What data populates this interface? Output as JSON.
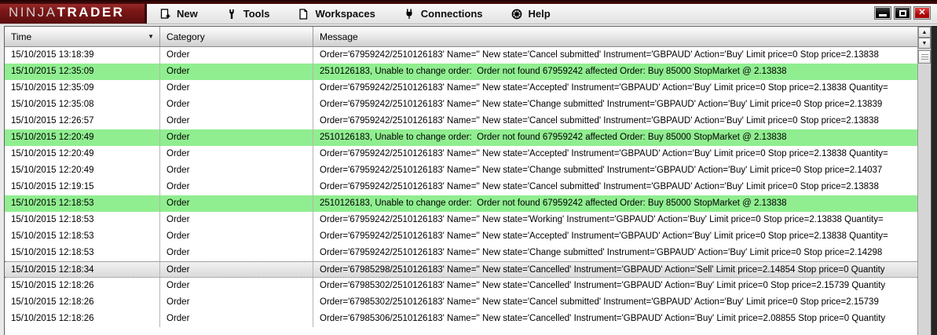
{
  "window": {
    "logo": {
      "brand_light": "NINJA",
      "brand_bold": "TRADER"
    },
    "menu": [
      {
        "label": "New",
        "icon": "new-document-icon"
      },
      {
        "label": "Tools",
        "icon": "wrench-icon"
      },
      {
        "label": "Workspaces",
        "icon": "workspace-document-icon"
      },
      {
        "label": "Connections",
        "icon": "plug-icon"
      },
      {
        "label": "Help",
        "icon": "globe-icon"
      }
    ],
    "controls": [
      {
        "name": "minimize",
        "icon": "minimize-icon"
      },
      {
        "name": "maximize",
        "icon": "maximize-icon"
      },
      {
        "name": "close",
        "icon": "close-icon"
      }
    ]
  },
  "glyphs": {
    "sort_dropdown": "▼",
    "scroll_up": "▲",
    "scroll_down": "▼",
    "close": "✕"
  },
  "colors": {
    "brand_red": "#7c1717",
    "highlight_green": "#90EE90",
    "selected_gray": "#e2e2e2",
    "close_red": "#c41212"
  },
  "table": {
    "columns": [
      "Time",
      "Category",
      "Message"
    ],
    "rows": [
      {
        "time": "15/10/2015 13:18:39",
        "category": "Order",
        "state": "normal",
        "message": "Order='67959242/2510126183' Name='' New state='Cancel submitted' Instrument='GBPAUD' Action='Buy' Limit price=0 Stop price=2.13838"
      },
      {
        "time": "15/10/2015 12:35:09",
        "category": "Order",
        "state": "highlight",
        "message": "2510126183, Unable to change order:  Order not found 67959242 affected Order: Buy 85000 StopMarket @ 2.13838"
      },
      {
        "time": "15/10/2015 12:35:09",
        "category": "Order",
        "state": "normal",
        "message": "Order='67959242/2510126183' Name='' New state='Accepted' Instrument='GBPAUD' Action='Buy' Limit price=0 Stop price=2.13838 Quantity="
      },
      {
        "time": "15/10/2015 12:35:08",
        "category": "Order",
        "state": "normal",
        "message": "Order='67959242/2510126183' Name='' New state='Change submitted' Instrument='GBPAUD' Action='Buy' Limit price=0 Stop price=2.13839"
      },
      {
        "time": "15/10/2015 12:26:57",
        "category": "Order",
        "state": "normal",
        "message": "Order='67959242/2510126183' Name='' New state='Cancel submitted' Instrument='GBPAUD' Action='Buy' Limit price=0 Stop price=2.13838"
      },
      {
        "time": "15/10/2015 12:20:49",
        "category": "Order",
        "state": "highlight",
        "message": "2510126183, Unable to change order:  Order not found 67959242 affected Order: Buy 85000 StopMarket @ 2.13838"
      },
      {
        "time": "15/10/2015 12:20:49",
        "category": "Order",
        "state": "normal",
        "message": "Order='67959242/2510126183' Name='' New state='Accepted' Instrument='GBPAUD' Action='Buy' Limit price=0 Stop price=2.13838 Quantity="
      },
      {
        "time": "15/10/2015 12:20:49",
        "category": "Order",
        "state": "normal",
        "message": "Order='67959242/2510126183' Name='' New state='Change submitted' Instrument='GBPAUD' Action='Buy' Limit price=0 Stop price=2.14037"
      },
      {
        "time": "15/10/2015 12:19:15",
        "category": "Order",
        "state": "normal",
        "message": "Order='67959242/2510126183' Name='' New state='Cancel submitted' Instrument='GBPAUD' Action='Buy' Limit price=0 Stop price=2.13838"
      },
      {
        "time": "15/10/2015 12:18:53",
        "category": "Order",
        "state": "highlight",
        "message": "2510126183, Unable to change order:  Order not found 67959242 affected Order: Buy 85000 StopMarket @ 2.13838"
      },
      {
        "time": "15/10/2015 12:18:53",
        "category": "Order",
        "state": "normal",
        "message": "Order='67959242/2510126183' Name='' New state='Working' Instrument='GBPAUD' Action='Buy' Limit price=0 Stop price=2.13838 Quantity="
      },
      {
        "time": "15/10/2015 12:18:53",
        "category": "Order",
        "state": "normal",
        "message": "Order='67959242/2510126183' Name='' New state='Accepted' Instrument='GBPAUD' Action='Buy' Limit price=0 Stop price=2.13838 Quantity="
      },
      {
        "time": "15/10/2015 12:18:53",
        "category": "Order",
        "state": "normal",
        "message": "Order='67959242/2510126183' Name='' New state='Change submitted' Instrument='GBPAUD' Action='Buy' Limit price=0 Stop price=2.14298"
      },
      {
        "time": "15/10/2015 12:18:34",
        "category": "Order",
        "state": "selected",
        "message": "Order='67985298/2510126183' Name='' New state='Cancelled' Instrument='GBPAUD' Action='Sell' Limit price=2.14854 Stop price=0 Quantity"
      },
      {
        "time": "15/10/2015 12:18:26",
        "category": "Order",
        "state": "normal",
        "message": "Order='67985302/2510126183' Name='' New state='Cancelled' Instrument='GBPAUD' Action='Buy' Limit price=0 Stop price=2.15739 Quantity"
      },
      {
        "time": "15/10/2015 12:18:26",
        "category": "Order",
        "state": "normal",
        "message": "Order='67985302/2510126183' Name='' New state='Cancel submitted' Instrument='GBPAUD' Action='Buy' Limit price=0 Stop price=2.15739"
      },
      {
        "time": "15/10/2015 12:18:26",
        "category": "Order",
        "state": "normal",
        "message": "Order='67985306/2510126183' Name='' New state='Cancelled' Instrument='GBPAUD' Action='Buy' Limit price=2.08855 Stop price=0 Quantity"
      }
    ]
  }
}
